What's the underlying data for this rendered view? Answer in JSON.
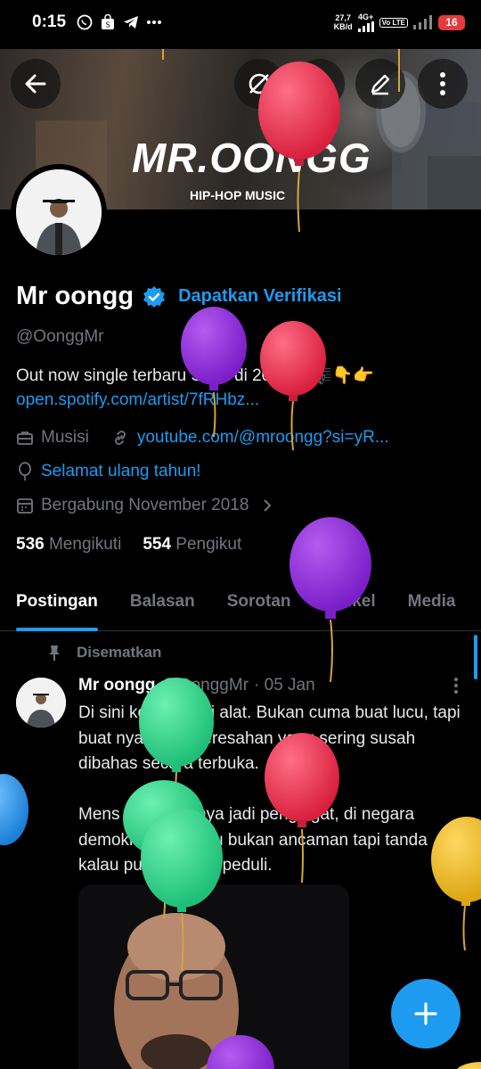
{
  "status_bar": {
    "time": "0:15",
    "speed": "27,7",
    "speed_unit": "KB/d",
    "network": "4G+",
    "volte": "Vo LTE",
    "battery": "16"
  },
  "banner": {
    "title": "MR.OONGG",
    "subtitle": "HIP-HOP MUSIC"
  },
  "header_buttons": {
    "back_icon": "arrow-left",
    "grok_icon": "slash-circle",
    "search_icon": "magnifier",
    "edit_icon": "pencil",
    "more_icon": "vertical-dots"
  },
  "profile": {
    "name": "Mr oongg",
    "verify_link": "Dapatkan Verifikasi",
    "handle": "@OonggMr",
    "bio": "Out now single terbaru Saya di 2025🎵🎼👇👉",
    "bio_link": "open.spotify.com/artist/7fRHbz...",
    "category": "Musisi",
    "website": "youtube.com/@mroongg?si=yR...",
    "birthday": "Selamat ulang tahun!",
    "joined": "Bergabung November 2018",
    "following_count": "536",
    "following_label": "Mengikuti",
    "followers_count": "554",
    "followers_label": "Pengikut"
  },
  "tabs": [
    {
      "label": "Postingan",
      "active": true
    },
    {
      "label": "Balasan",
      "active": false
    },
    {
      "label": "Sorotan",
      "active": false
    },
    {
      "label": "Artikel",
      "active": false
    },
    {
      "label": "Media",
      "active": false
    }
  ],
  "pinned_post": {
    "pinned_label": "Disematkan",
    "author": "Mr oongg",
    "handle": "@OonggMr",
    "date": "· 05 Jan",
    "text": "Di sini komedi jadi alat. Bukan cuma buat lucu, tapi buat nyampein keresahan yang sering susah dibahas secara terbuka.\n\nMens Rea akhirnya jadi pengingat, di negara demokrasi, kritik itu bukan ancaman tapi tanda kalau publik masih peduli."
  },
  "colors": {
    "accent": "#1d9bf0",
    "muted": "#71767b",
    "background": "#000000",
    "balloon_red": "#e0344f",
    "balloon_purple": "#8a2bd6",
    "balloon_green": "#2ed18a",
    "balloon_yellow": "#e6b31e",
    "balloon_blue": "#2a8fe0"
  }
}
